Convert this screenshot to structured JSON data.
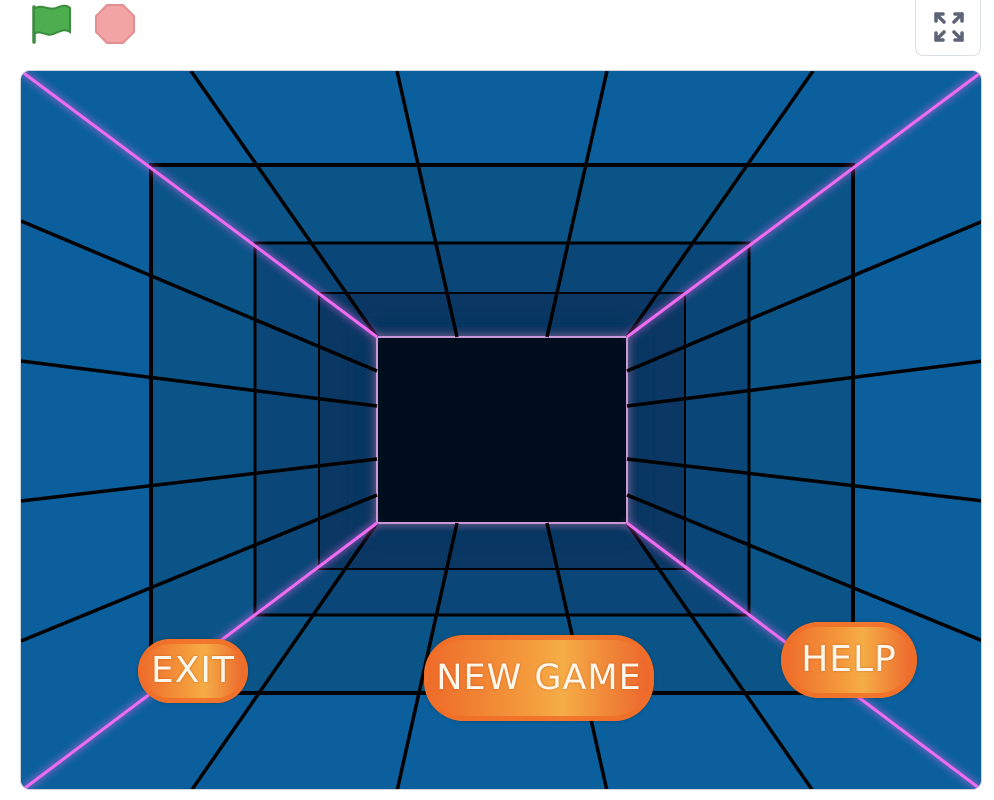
{
  "toolbar": {
    "green_flag_icon": "green-flag-icon",
    "stop_icon": "stop-sign-icon",
    "fullscreen_icon": "fullscreen-icon",
    "colors": {
      "flag": "#4cae4f",
      "stop": "#f2a3a3",
      "fullscreen_arrows": "#5d6478"
    }
  },
  "stage": {
    "colors": {
      "wall": "#0a5f9c",
      "void": "#04101a",
      "neon": "#f06cf0",
      "grid_line": "#050a10"
    },
    "buttons": {
      "exit": "EXIT",
      "new_game": "NEW GAME",
      "help": "HELP"
    }
  }
}
